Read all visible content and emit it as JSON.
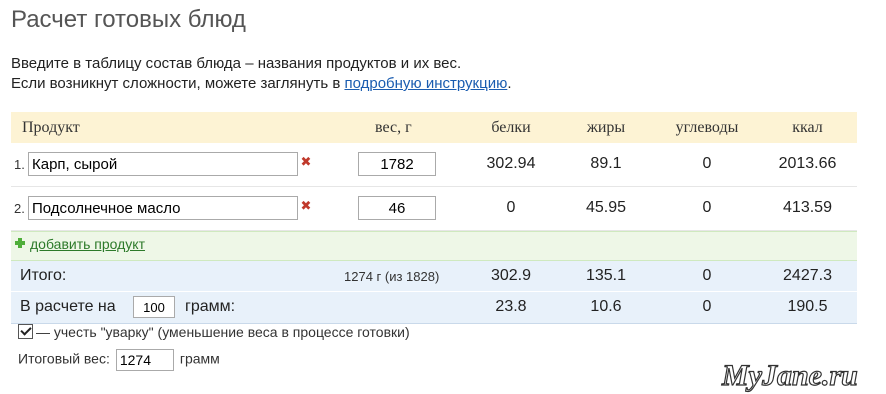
{
  "title": "Расчет готовых блюд",
  "intro": {
    "line1": "Введите в таблицу состав блюда – названия продуктов и их вес.",
    "line2_prefix": "Если возникнут сложности, можете заглянуть в ",
    "link": "подробную инструкцию",
    "line2_suffix": "."
  },
  "table": {
    "headers": {
      "product": "Продукт",
      "weight": "вес, г",
      "protein": "белки",
      "fat": "жиры",
      "carbs": "углеводы",
      "kcal": "ккал"
    },
    "rows": [
      {
        "num": "1.",
        "name": "Карп, сырой",
        "weight": "1782",
        "protein": "302.94",
        "fat": "89.1",
        "carbs": "0",
        "kcal": "2013.66",
        "delete_icon": "red-cross-icon"
      },
      {
        "num": "2.",
        "name": "Подсолнечное масло",
        "weight": "46",
        "protein": "0",
        "fat": "45.95",
        "carbs": "0",
        "kcal": "413.59",
        "delete_icon": "red-cross-icon"
      }
    ],
    "add_product": "добавить продукт",
    "total": {
      "label": "Итого:",
      "weight_note": "1274 г (из 1828)",
      "protein": "302.9",
      "fat": "135.1",
      "carbs": "0",
      "kcal": "2427.3"
    },
    "per": {
      "label1": "В расчете на",
      "amount": "100",
      "label2": "грамм:",
      "protein": "23.8",
      "fat": "10.6",
      "carbs": "0",
      "kcal": "190.5"
    }
  },
  "options": {
    "boil_off_checked": true,
    "boil_off_label": "— учесть \"уварку\" (уменьшение веса в процессе готовки)",
    "final_weight_label": "Итоговый вес:",
    "final_weight_value": "1274",
    "final_weight_unit": "грамм"
  },
  "watermark": "MyJane.ru",
  "colors": {
    "header_bg": "#fdf3d4",
    "total_bg": "#e8f1fa",
    "add_bg": "#eef7e7",
    "link": "#1a5cb0",
    "delete": "#c0392b"
  }
}
